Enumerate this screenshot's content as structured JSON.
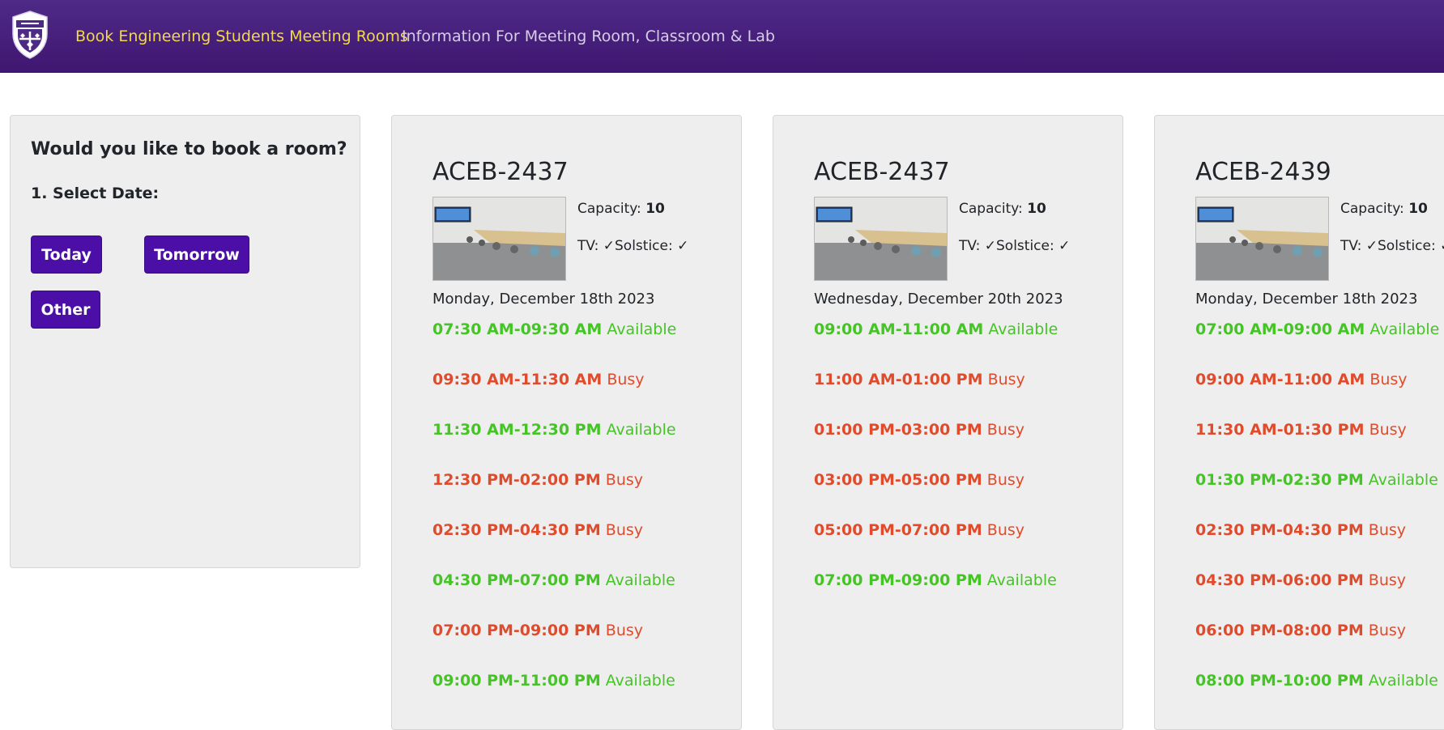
{
  "nav": {
    "brand": "Book Engineering Students Meeting Rooms",
    "info_link": "Information For Meeting Room, Classroom & Lab"
  },
  "booking": {
    "title": "Would you like to book a room?",
    "step_label": "1. Select Date:",
    "today_label": "Today",
    "tomorrow_label": "Tomorrow",
    "other_label": "Other"
  },
  "labels": {
    "capacity": "Capacity: ",
    "tv": "TV: ",
    "solstice": "Solstice: ",
    "check": "✓"
  },
  "colors": {
    "navbar": "#3f1670",
    "brand_text": "#f2d84a",
    "button": "#4b0fa8",
    "available": "#44c425",
    "busy": "#e04b2c"
  },
  "rooms": [
    {
      "name": "ACEB-2437",
      "capacity": "10",
      "date": "Monday, December 18th 2023",
      "slots": [
        {
          "time": "07:30 AM-09:30 AM",
          "status": "Available"
        },
        {
          "time": "09:30 AM-11:30 AM",
          "status": "Busy"
        },
        {
          "time": "11:30 AM-12:30 PM",
          "status": "Available"
        },
        {
          "time": "12:30 PM-02:00 PM",
          "status": "Busy"
        },
        {
          "time": "02:30 PM-04:30 PM",
          "status": "Busy"
        },
        {
          "time": "04:30 PM-07:00 PM",
          "status": "Available"
        },
        {
          "time": "07:00 PM-09:00 PM",
          "status": "Busy"
        },
        {
          "time": "09:00 PM-11:00 PM",
          "status": "Available"
        }
      ]
    },
    {
      "name": "ACEB-2437",
      "capacity": "10",
      "date": "Wednesday, December 20th 2023",
      "slots": [
        {
          "time": "09:00 AM-11:00 AM",
          "status": "Available"
        },
        {
          "time": "11:00 AM-01:00 PM",
          "status": "Busy"
        },
        {
          "time": "01:00 PM-03:00 PM",
          "status": "Busy"
        },
        {
          "time": "03:00 PM-05:00 PM",
          "status": "Busy"
        },
        {
          "time": "05:00 PM-07:00 PM",
          "status": "Busy"
        },
        {
          "time": "07:00 PM-09:00 PM",
          "status": "Available"
        }
      ]
    },
    {
      "name": "ACEB-2439",
      "capacity": "10",
      "date": "Monday, December 18th 2023",
      "slots": [
        {
          "time": "07:00 AM-09:00 AM",
          "status": "Available"
        },
        {
          "time": "09:00 AM-11:00 AM",
          "status": "Busy"
        },
        {
          "time": "11:30 AM-01:30 PM",
          "status": "Busy"
        },
        {
          "time": "01:30 PM-02:30 PM",
          "status": "Available"
        },
        {
          "time": "02:30 PM-04:30 PM",
          "status": "Busy"
        },
        {
          "time": "04:30 PM-06:00 PM",
          "status": "Busy"
        },
        {
          "time": "06:00 PM-08:00 PM",
          "status": "Busy"
        },
        {
          "time": "08:00 PM-10:00 PM",
          "status": "Available"
        }
      ]
    }
  ]
}
